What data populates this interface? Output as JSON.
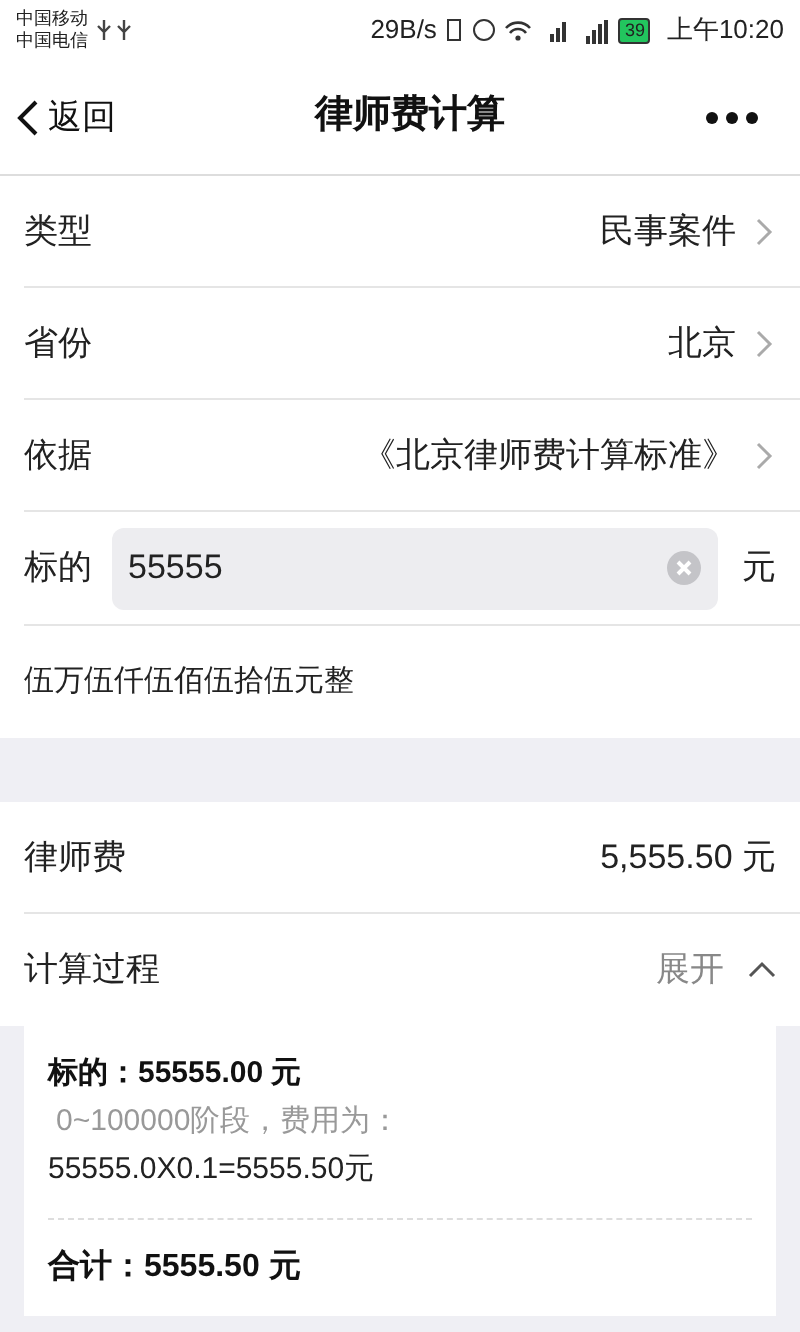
{
  "status_bar": {
    "carriers": [
      "中国移动",
      "中国电信"
    ],
    "speed": "29B/s",
    "battery": "39",
    "time": "上午10:20"
  },
  "nav": {
    "back": "返回",
    "title": "律师费计算"
  },
  "form": [
    {
      "kind": "select",
      "label": "类型",
      "value": "民事案件"
    },
    {
      "kind": "select",
      "label": "省份",
      "value": "北京"
    },
    {
      "kind": "select",
      "label": "依据",
      "value": "《北京律师费计算标准》"
    },
    {
      "kind": "input",
      "label": "标的",
      "value": "55555",
      "unit": "元"
    },
    {
      "kind": "note",
      "text": "伍万伍仟伍佰伍拾伍元整"
    }
  ],
  "result": {
    "fee_label": "律师费",
    "fee": "5,555.50 元",
    "process_label": "计算过程",
    "toggle": "展开",
    "expanded": true
  },
  "details": {
    "amount": "标的：55555.00 元",
    "stage": "0~100000阶段，费用为：",
    "formula": "55555.0X0.1=5555.50元",
    "total": "合计：5555.50 元"
  }
}
